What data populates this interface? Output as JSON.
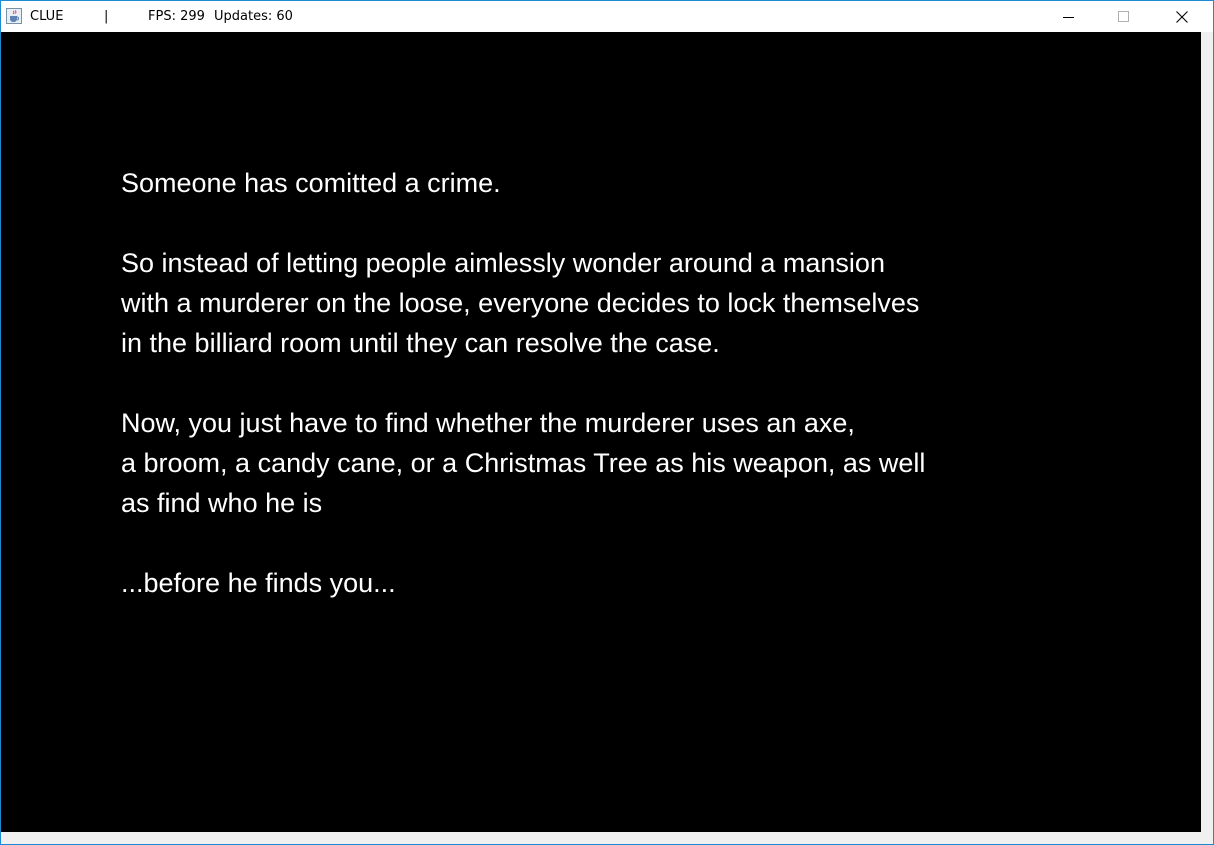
{
  "window": {
    "title": "CLUE",
    "separator": "|",
    "fps_text": "FPS: 299",
    "updates_text": "Updates: 60",
    "accent_border": "#1a8ad4"
  },
  "icons": {
    "app": "java-cup-icon",
    "minimize": "minimize-icon",
    "maximize": "maximize-icon",
    "close": "close-icon"
  },
  "game": {
    "background": "#000000",
    "text_color": "#ffffff",
    "paragraphs": [
      "Someone has comitted a crime.",
      "So instead of letting people aimlessly wonder around a mansion\nwith a murderer on the loose, everyone decides to lock themselves\nin the billiard room until they can resolve the case.",
      "Now, you just have to find whether the murderer uses an axe,\na broom, a candy cane, or a Christmas Tree as his weapon, as well\nas find who he is",
      "...before he finds you..."
    ]
  }
}
